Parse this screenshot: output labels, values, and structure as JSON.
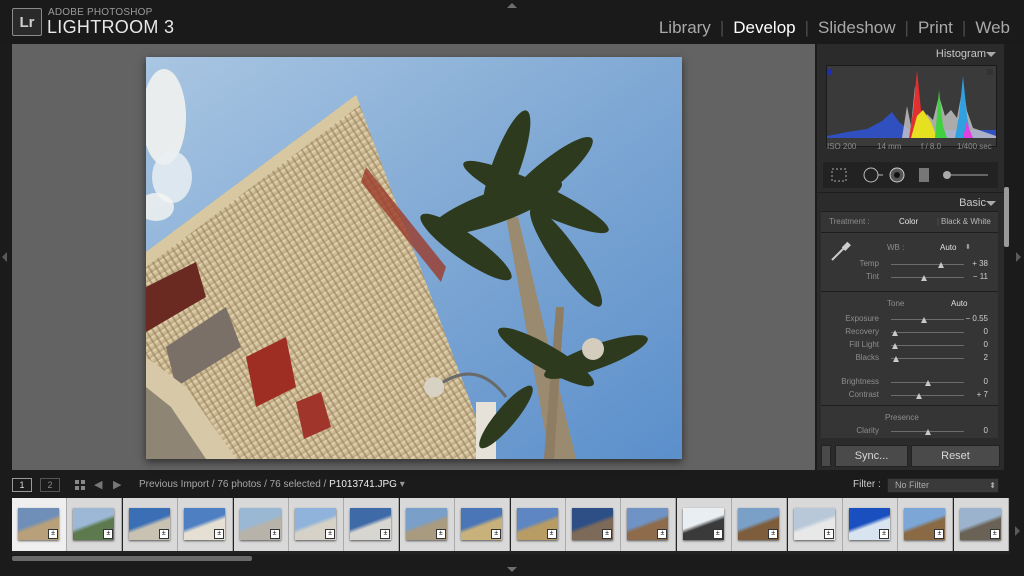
{
  "app": {
    "brand_small": "ADOBE PHOTOSHOP",
    "brand_big": "LIGHTROOM 3",
    "logo": "Lr",
    "modules": [
      "Library",
      "Develop",
      "Slideshow",
      "Print",
      "Web"
    ],
    "active_module": "Develop"
  },
  "histogram": {
    "title": "Histogram",
    "iso": "ISO 200",
    "focal": "14 mm",
    "aperture": "f / 8.0",
    "shutter": "1/400 sec"
  },
  "tools": [
    "crop-overlay-icon",
    "spot-removal-icon",
    "red-eye-icon",
    "graduated-filter-icon",
    "adjustment-brush-icon"
  ],
  "basic": {
    "title": "Basic",
    "treatment_label": "Treatment :",
    "treatment_color": "Color",
    "treatment_bw": "Black & White",
    "wb_label": "WB :",
    "wb_value": "Auto",
    "wb_sliders": [
      {
        "label": "Temp",
        "value": "+ 38",
        "level": 0.68
      },
      {
        "label": "Tint",
        "value": "− 11",
        "level": 0.45
      }
    ],
    "tone_label": "Tone",
    "tone_auto": "Auto",
    "tone_sliders": [
      {
        "label": "Exposure",
        "value": "− 0.55",
        "level": 0.45
      },
      {
        "label": "Recovery",
        "value": "0",
        "level": 0.05
      },
      {
        "label": "Fill Light",
        "value": "0",
        "level": 0.05
      },
      {
        "label": "Blacks",
        "value": "2",
        "level": 0.07
      }
    ],
    "bc_sliders": [
      {
        "label": "Brightness",
        "value": "0",
        "level": 0.5
      },
      {
        "label": "Contrast",
        "value": "+ 7",
        "level": 0.38
      }
    ],
    "presence_label": "Presence",
    "presence_sliders": [
      {
        "label": "Clarity",
        "value": "0",
        "level": 0.5
      }
    ]
  },
  "buttons": {
    "sync": "Sync...",
    "reset": "Reset"
  },
  "filmstrip_bar": {
    "view1": "1",
    "view2": "2",
    "path": "Previous Import / 76 photos / 76 selected / ",
    "filename": "P1013741.JPG",
    "filter_label": "Filter :",
    "filter_value": "No Filter"
  },
  "thumbnails": [
    {
      "sky": "#6f8fb8",
      "main": "#b8a07a"
    },
    {
      "sky": "#9cb8d6",
      "main": "#5d7a4e"
    },
    {
      "sky": "#3a6fb5",
      "main": "#c9c2b2"
    },
    {
      "sky": "#4e7fc2",
      "main": "#e6e0d4"
    },
    {
      "sky": "#9ab7d4",
      "main": "#b8b3a8"
    },
    {
      "sky": "#8fb3da",
      "main": "#d6d2c8"
    },
    {
      "sky": "#3e6aa8",
      "main": "#d8d6d0"
    },
    {
      "sky": "#7a9fc9",
      "main": "#a99b80"
    },
    {
      "sky": "#4a76b8",
      "main": "#c8b17a"
    },
    {
      "sky": "#5d86c2",
      "main": "#b99c64"
    },
    {
      "sky": "#2d4f86",
      "main": "#7d6a58"
    },
    {
      "sky": "#6e93c4",
      "main": "#8d6b4b"
    },
    {
      "sky": "#e8eef2",
      "main": "#3a3a3a"
    },
    {
      "sky": "#7aa0c8",
      "main": "#7e5d3d"
    },
    {
      "sky": "#b8c8d8",
      "main": "#e8e8e8"
    },
    {
      "sky": "#1a4fc0",
      "main": "#d8e4f0"
    },
    {
      "sky": "#7ba6d6",
      "main": "#8a6a44"
    },
    {
      "sky": "#9bb3cc",
      "main": "#6b6256"
    }
  ]
}
